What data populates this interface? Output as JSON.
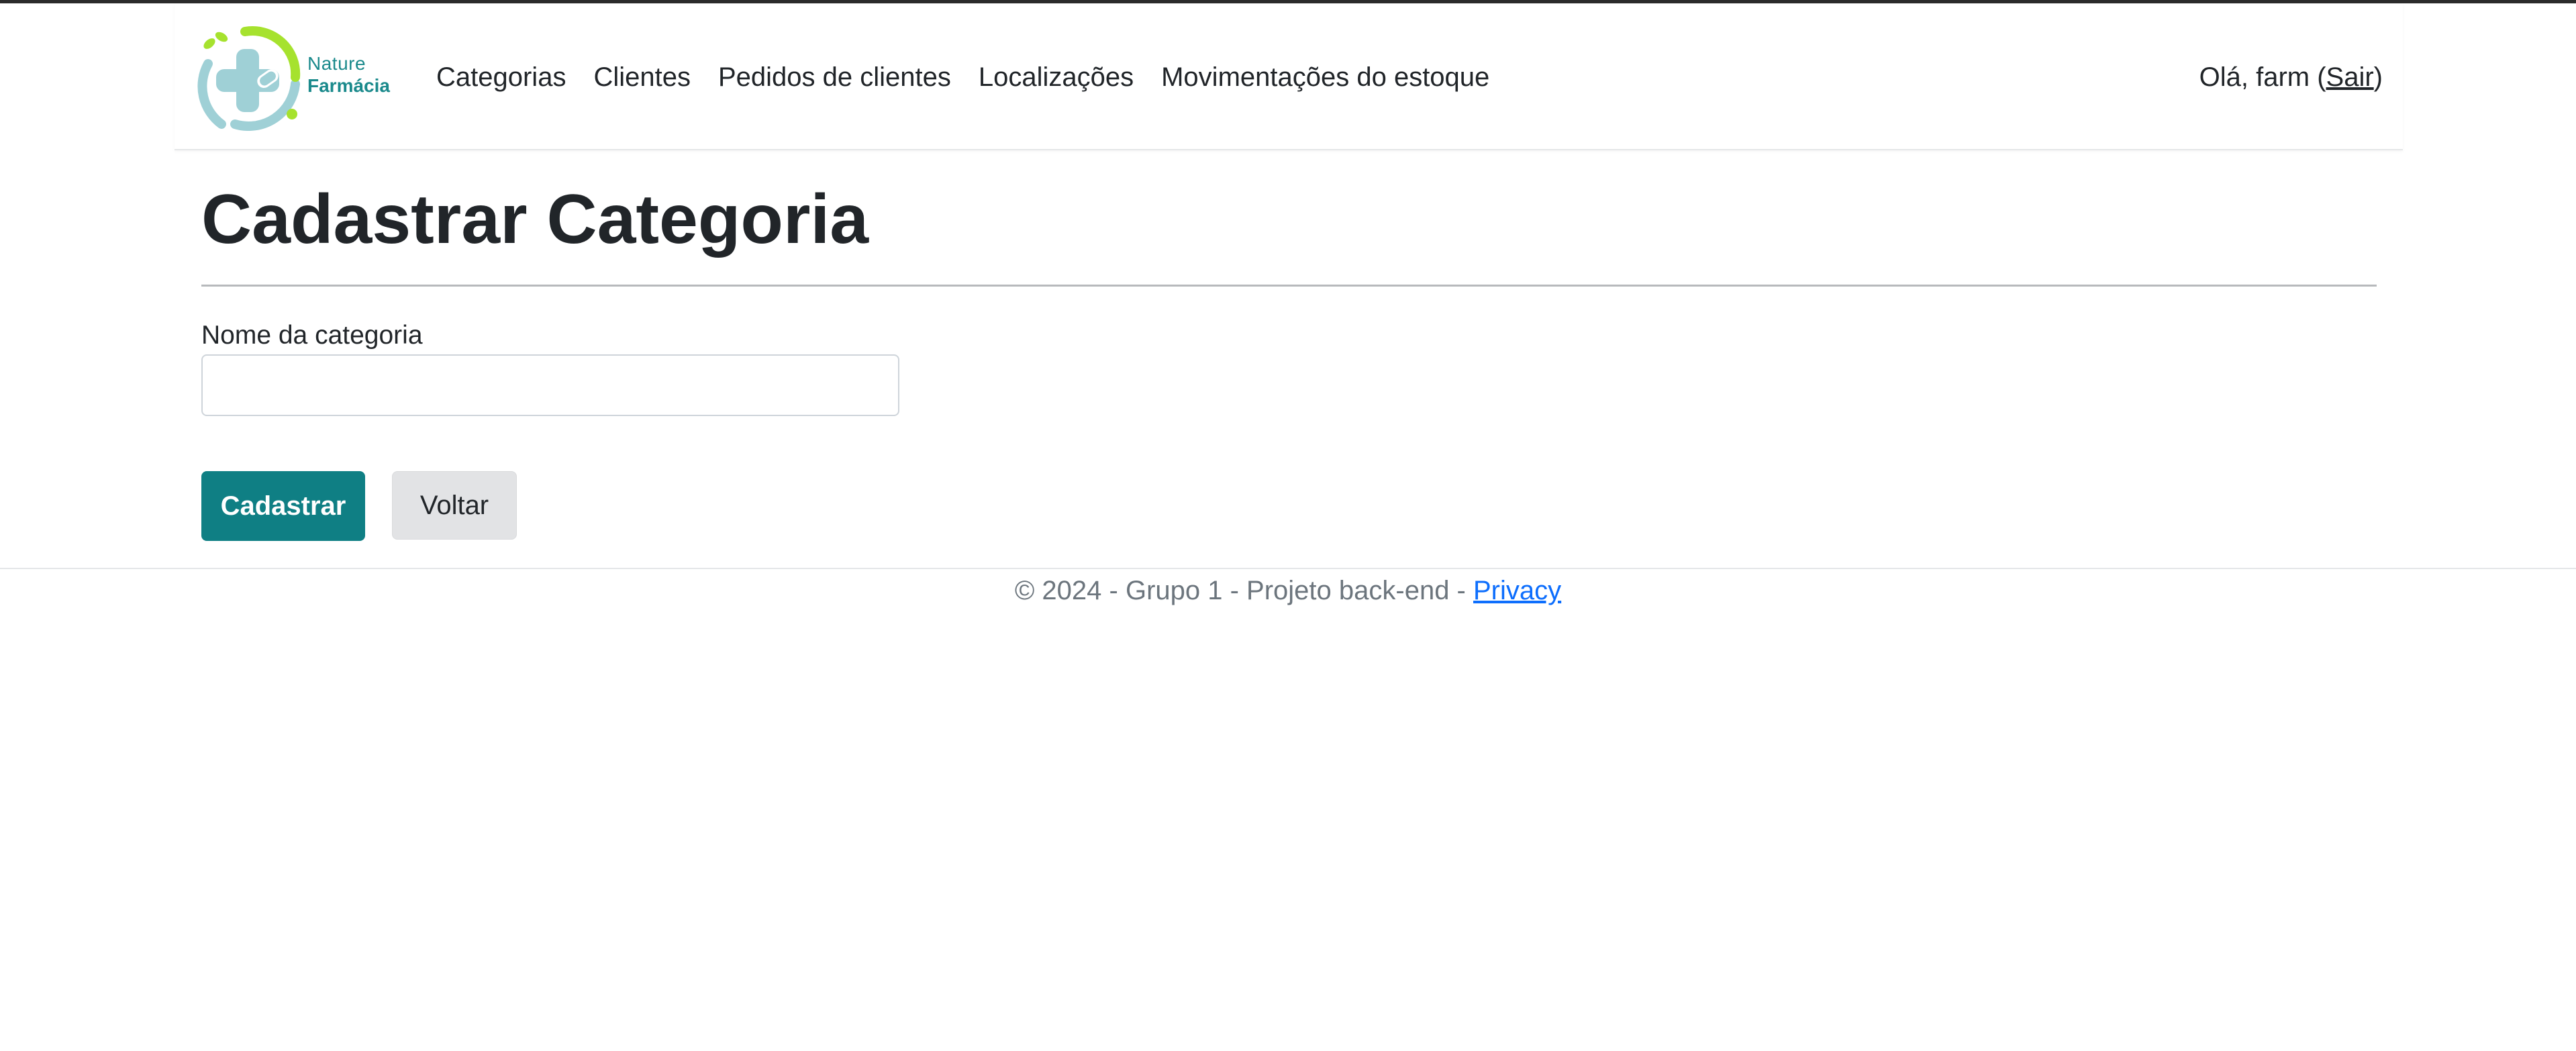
{
  "brand": {
    "name_line1": "Nature",
    "name_line2": "Farmácia",
    "colors": {
      "primary": "#1b8a8c",
      "accent": "#a6e22e",
      "muted": "#9fd0d6"
    }
  },
  "nav": {
    "items": [
      {
        "label": "Categorias"
      },
      {
        "label": "Clientes"
      },
      {
        "label": "Pedidos de clientes"
      },
      {
        "label": "Localizações"
      },
      {
        "label": "Movimentações do estoque"
      }
    ]
  },
  "user": {
    "greeting": "Olá, farm (",
    "logout_label": "Sair",
    "close_paren": ")"
  },
  "page": {
    "title": "Cadastrar Categoria"
  },
  "form": {
    "category_name_label": "Nome da categoria",
    "category_name_value": "",
    "category_name_placeholder": "",
    "submit_label": "Cadastrar",
    "back_label": "Voltar"
  },
  "footer": {
    "text": "© 2024 - Grupo 1 - Projeto back-end - ",
    "privacy_label": "Privacy"
  },
  "colors": {
    "primary_button": "#0f7f84",
    "secondary_button": "#e2e3e5",
    "link": "#0d6efd"
  }
}
